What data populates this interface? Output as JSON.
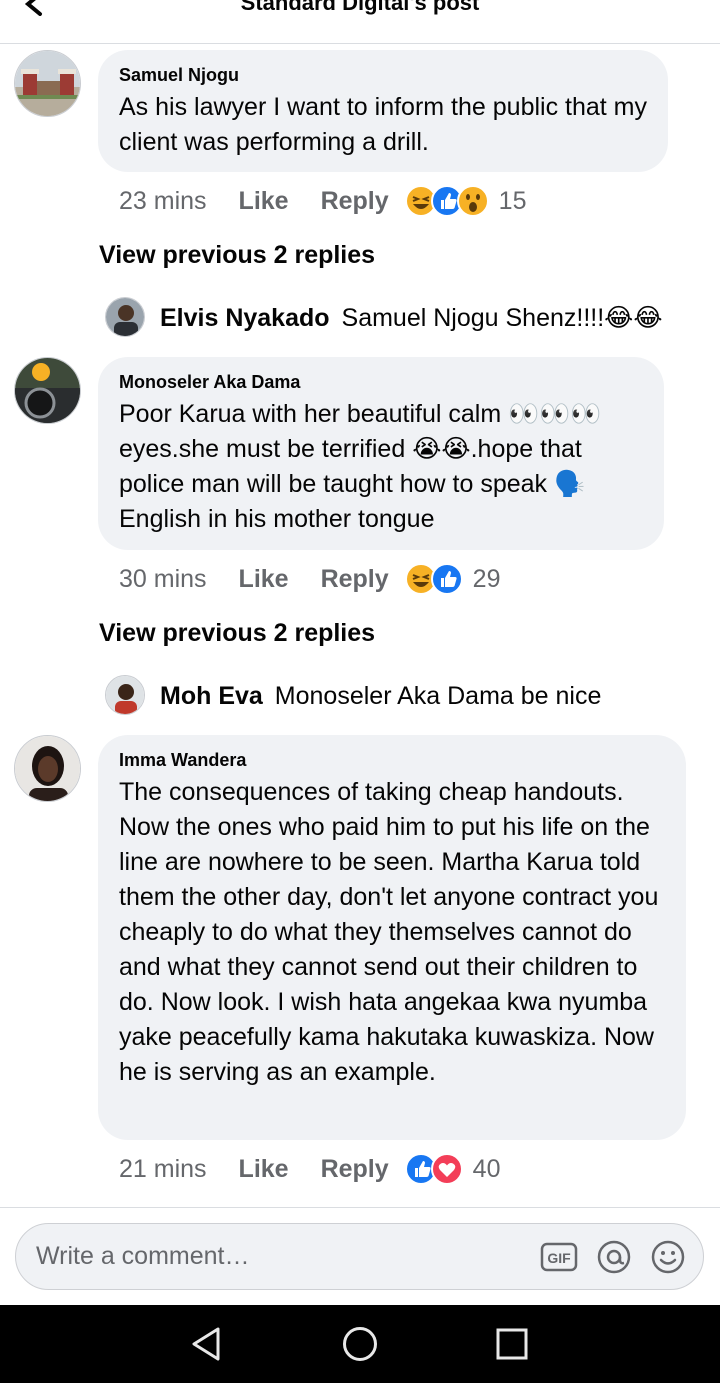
{
  "header": {
    "title": "Standard Digital's post"
  },
  "comments": [
    {
      "author": "Samuel Njogu",
      "text": "As his lawyer I want to inform the public that my client was performing a drill.",
      "time": "23 mins",
      "like": "Like",
      "reply": "Reply",
      "reactions": [
        "haha",
        "like",
        "wow"
      ],
      "reaction_count": "15",
      "view_previous": "View previous 2 replies",
      "reply_preview": {
        "author": "Elvis Nyakado",
        "text": "Samuel Njogu Shenz!!!!😂😂"
      }
    },
    {
      "author": "Monoseler Aka Dama",
      "text": "Poor Karua with her beautiful calm 👀👀👀 eyes.she must be terrified 😭😭.hope that police man will be taught how to speak 🗣️ English in his mother tongue",
      "time": "30 mins",
      "like": "Like",
      "reply": "Reply",
      "reactions": [
        "haha",
        "like"
      ],
      "reaction_count": "29",
      "view_previous": "View previous 2 replies",
      "reply_preview": {
        "author": "Moh Eva",
        "text": "Monoseler Aka Dama be nice"
      }
    },
    {
      "author": "Imma Wandera",
      "text": "The consequences of taking cheap handouts. Now the ones who paid him to put his life on the line are nowhere to be seen. Martha Karua told them the other day, don't let anyone contract you cheaply to do what they themselves cannot do and what they cannot send out their children to do. Now look. I wish hata angekaa kwa nyumba yake peacefully kama hakutaka kuwaskiza. Now he is serving as an example.",
      "time": "21 mins",
      "like": "Like",
      "reply": "Reply",
      "reactions": [
        "like",
        "love"
      ],
      "reaction_count": "40"
    }
  ],
  "composer": {
    "placeholder": "Write a comment…",
    "icons": [
      "gif-icon",
      "mention-icon",
      "emoji-icon"
    ],
    "gif_label": "GIF"
  },
  "navbar": {
    "icons": [
      "back-triangle-icon",
      "home-circle-icon",
      "recents-square-icon"
    ]
  },
  "colors": {
    "bubble": "#f0f2f5",
    "meta_text": "#65676b",
    "like_blue": "#1877f2",
    "love_red": "#f33e58",
    "haha_yellow": "#f7b125"
  }
}
